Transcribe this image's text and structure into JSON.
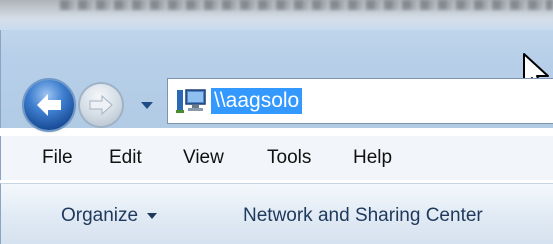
{
  "address_bar": {
    "path": "\\\\aagsolo"
  },
  "menu": {
    "items": [
      "File",
      "Edit",
      "View",
      "Tools",
      "Help"
    ]
  },
  "commandbar": {
    "organize_label": "Organize",
    "network_label": "Network and Sharing Center"
  },
  "colors": {
    "selection": "#3399ff",
    "glass": "#b7cfe8",
    "command_text": "#1e395b"
  },
  "icons": {
    "back": "back-arrow-icon",
    "forward": "forward-arrow-icon",
    "history": "chevron-down-icon",
    "location": "network-computer-icon",
    "pointer": "mouse-pointer-icon"
  }
}
